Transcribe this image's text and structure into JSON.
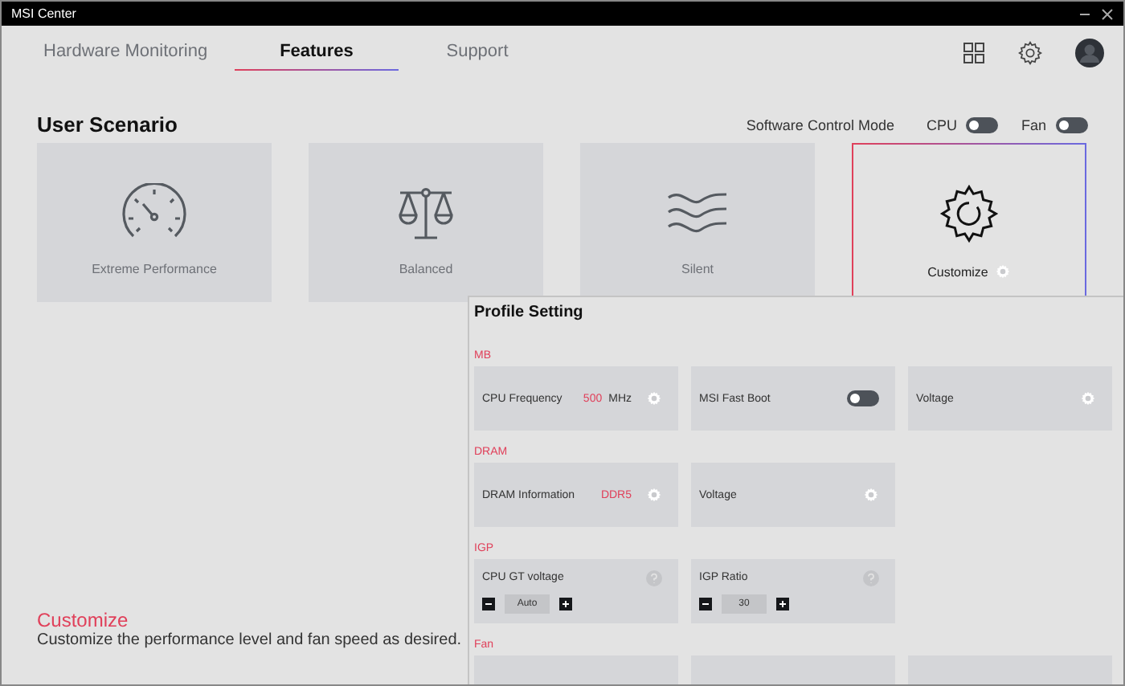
{
  "window": {
    "title": "MSI Center"
  },
  "tabs": [
    {
      "label": "Hardware Monitoring",
      "selected": false
    },
    {
      "label": "Features",
      "selected": true
    },
    {
      "label": "Support",
      "selected": false
    }
  ],
  "section_title": "User Scenario",
  "software_control": {
    "label": "Software Control Mode",
    "toggles": [
      {
        "label": "CPU",
        "on": false
      },
      {
        "label": "Fan",
        "on": false
      }
    ]
  },
  "scenarios": [
    {
      "label": "Extreme Performance",
      "kind": "gauge",
      "selected": false
    },
    {
      "label": "Balanced",
      "kind": "scale",
      "selected": false
    },
    {
      "label": "Silent",
      "kind": "waves",
      "selected": false
    },
    {
      "label": "Customize",
      "kind": "gear",
      "selected": true
    }
  ],
  "description": {
    "title": "Customize",
    "text": "Customize the performance level and fan speed as desired."
  },
  "profile": {
    "title": "Profile Setting",
    "groups": [
      {
        "name": "MB",
        "items": [
          {
            "kind": "value",
            "label": "CPU Frequency",
            "value": "500",
            "unit": "MHz"
          },
          {
            "kind": "toggle",
            "label": "MSI Fast Boot",
            "on": false
          },
          {
            "kind": "gear",
            "label": "Voltage"
          }
        ]
      },
      {
        "name": "DRAM",
        "items": [
          {
            "kind": "value",
            "label": "DRAM Information",
            "value": "DDR5"
          },
          {
            "kind": "gear",
            "label": "Voltage"
          }
        ]
      },
      {
        "name": "IGP",
        "items": [
          {
            "kind": "stepper",
            "label": "CPU GT voltage",
            "value": "Auto"
          },
          {
            "kind": "stepper",
            "label": "IGP Ratio",
            "value": "30"
          }
        ]
      },
      {
        "name": "Fan",
        "items": [
          {
            "kind": "blank"
          },
          {
            "kind": "blank"
          },
          {
            "kind": "blank"
          }
        ]
      }
    ]
  }
}
